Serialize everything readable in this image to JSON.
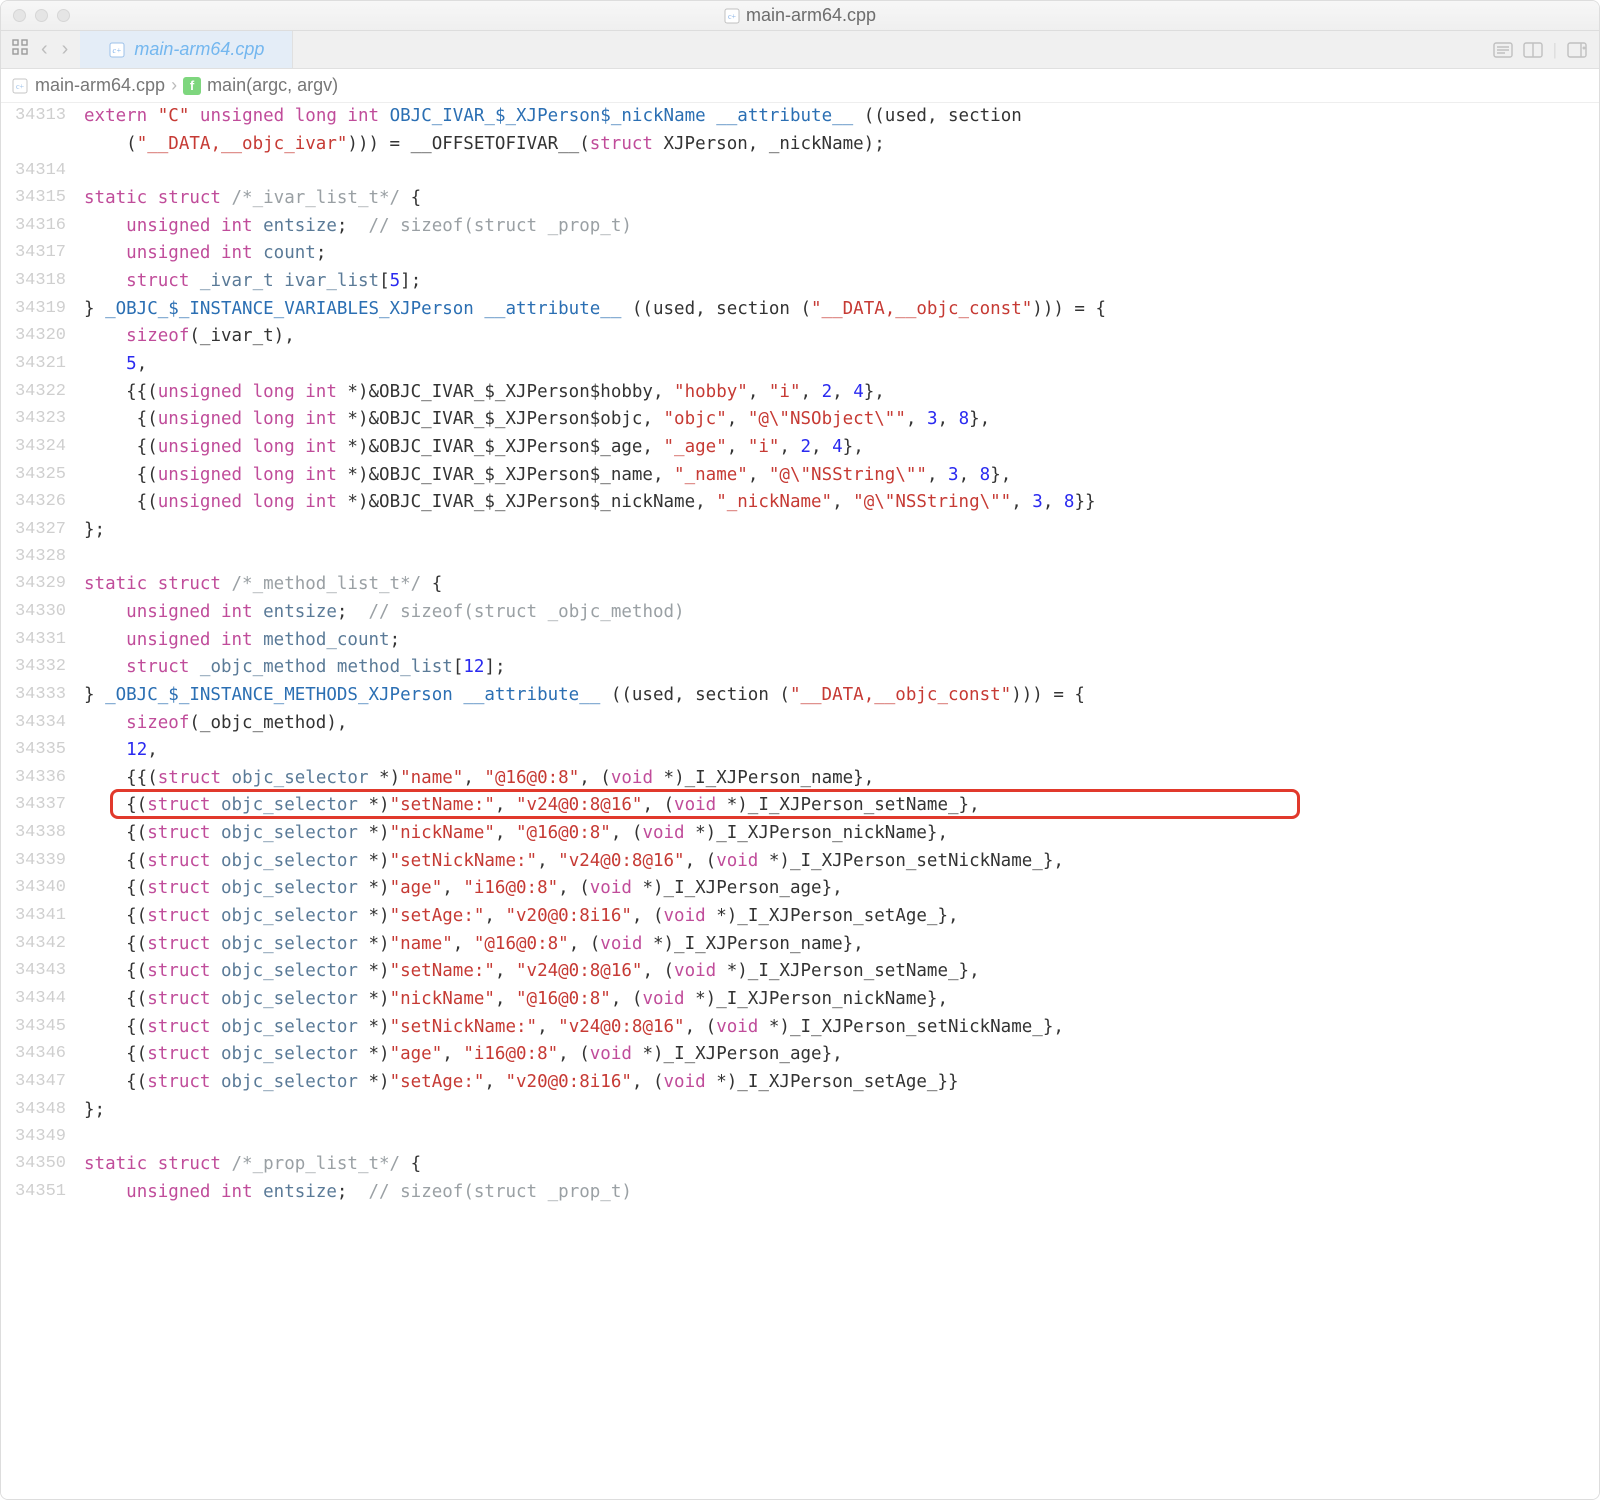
{
  "window": {
    "title": "main-arm64.cpp"
  },
  "tab": {
    "label": "main-arm64.cpp"
  },
  "breadcrumb": {
    "file": "main-arm64.cpp",
    "symbol": "main(argc, argv)"
  },
  "code": {
    "first_visible_line": 34313,
    "lines": [
      {
        "n": 34313,
        "html": "<span class='kw'>extern</span> <span class='str'>\"C\"</span> <span class='kw'>unsigned long int</span> <span class='idf'>OBJC_IVAR_$_XJPerson$_nickName</span> <span class='idf'>__attribute__</span> ((used, section"
      },
      {
        "n": null,
        "html": "    (<span class='str'>\"__DATA,__objc_ivar\"</span>))) = __OFFSETOFIVAR__(<span class='kw'>struct</span> XJPerson, _nickName);"
      },
      {
        "n": 34314,
        "html": ""
      },
      {
        "n": 34315,
        "html": "<span class='kw'>static struct</span> <span class='cm'>/*_ivar_list_t*/</span> {"
      },
      {
        "n": 34316,
        "html": "    <span class='kw'>unsigned int</span> <span class='ty'>entsize</span>;  <span class='cm'>// sizeof(struct _prop_t)</span>"
      },
      {
        "n": 34317,
        "html": "    <span class='kw'>unsigned int</span> <span class='ty'>count</span>;"
      },
      {
        "n": 34318,
        "html": "    <span class='kw'>struct</span> <span class='ty'>_ivar_t</span> <span class='ty'>ivar_list</span>[<span class='num'>5</span>];"
      },
      {
        "n": 34319,
        "html": "} <span class='idf'>_OBJC_$_INSTANCE_VARIABLES_XJPerson</span> <span class='idf'>__attribute__</span> ((used, section (<span class='str'>\"__DATA,__objc_const\"</span>))) = {"
      },
      {
        "n": 34320,
        "html": "    <span class='kw'>sizeof</span>(_ivar_t),"
      },
      {
        "n": 34321,
        "html": "    <span class='num'>5</span>,"
      },
      {
        "n": 34322,
        "html": "    {{(<span class='kw'>unsigned long int</span> *)&amp;OBJC_IVAR_$_XJPerson$hobby, <span class='str'>\"hobby\"</span>, <span class='str'>\"i\"</span>, <span class='num'>2</span>, <span class='num'>4</span>},"
      },
      {
        "n": 34323,
        "html": "     {(<span class='kw'>unsigned long int</span> *)&amp;OBJC_IVAR_$_XJPerson$objc, <span class='str'>\"objc\"</span>, <span class='str'>\"@\\\"NSObject\\\"\"</span>, <span class='num'>3</span>, <span class='num'>8</span>},"
      },
      {
        "n": 34324,
        "html": "     {(<span class='kw'>unsigned long int</span> *)&amp;OBJC_IVAR_$_XJPerson$_age, <span class='str'>\"_age\"</span>, <span class='str'>\"i\"</span>, <span class='num'>2</span>, <span class='num'>4</span>},"
      },
      {
        "n": 34325,
        "html": "     {(<span class='kw'>unsigned long int</span> *)&amp;OBJC_IVAR_$_XJPerson$_name, <span class='str'>\"_name\"</span>, <span class='str'>\"@\\\"NSString\\\"\"</span>, <span class='num'>3</span>, <span class='num'>8</span>},"
      },
      {
        "n": 34326,
        "html": "     {(<span class='kw'>unsigned long int</span> *)&amp;OBJC_IVAR_$_XJPerson$_nickName, <span class='str'>\"_nickName\"</span>, <span class='str'>\"@\\\"NSString\\\"\"</span>, <span class='num'>3</span>, <span class='num'>8</span>}}"
      },
      {
        "n": 34327,
        "html": "};"
      },
      {
        "n": 34328,
        "html": ""
      },
      {
        "n": 34329,
        "html": "<span class='kw'>static struct</span> <span class='cm'>/*_method_list_t*/</span> {"
      },
      {
        "n": 34330,
        "html": "    <span class='kw'>unsigned int</span> <span class='ty'>entsize</span>;  <span class='cm'>// sizeof(struct _objc_method)</span>"
      },
      {
        "n": 34331,
        "html": "    <span class='kw'>unsigned int</span> <span class='ty'>method_count</span>;"
      },
      {
        "n": 34332,
        "html": "    <span class='kw'>struct</span> <span class='ty'>_objc_method</span> <span class='ty'>method_list</span>[<span class='num'>12</span>];"
      },
      {
        "n": 34333,
        "html": "} <span class='idf'>_OBJC_$_INSTANCE_METHODS_XJPerson</span> <span class='idf'>__attribute__</span> ((used, section (<span class='str'>\"__DATA,__objc_const\"</span>))) = {"
      },
      {
        "n": 34334,
        "html": "    <span class='kw'>sizeof</span>(_objc_method),"
      },
      {
        "n": 34335,
        "html": "    <span class='num'>12</span>,"
      },
      {
        "n": 34336,
        "html": "    {{(<span class='kw'>struct</span> <span class='ty'>objc_selector</span> *)<span class='str'>\"name\"</span>, <span class='str'>\"@16@0:8\"</span>, (<span class='kw'>void</span> *)_I_XJPerson_name},"
      },
      {
        "n": 34337,
        "hl": true,
        "html": "    {(<span class='kw'>struct</span> <span class='ty'>objc_selector</span> *)<span class='str'>\"setName:\"</span>, <span class='str'>\"v24@0:8@16\"</span>, (<span class='kw'>void</span> *)_I_XJPerson_setName_},"
      },
      {
        "n": 34338,
        "html": "    {(<span class='kw'>struct</span> <span class='ty'>objc_selector</span> *)<span class='str'>\"nickName\"</span>, <span class='str'>\"@16@0:8\"</span>, (<span class='kw'>void</span> *)_I_XJPerson_nickName},"
      },
      {
        "n": 34339,
        "html": "    {(<span class='kw'>struct</span> <span class='ty'>objc_selector</span> *)<span class='str'>\"setNickName:\"</span>, <span class='str'>\"v24@0:8@16\"</span>, (<span class='kw'>void</span> *)_I_XJPerson_setNickName_},"
      },
      {
        "n": 34340,
        "html": "    {(<span class='kw'>struct</span> <span class='ty'>objc_selector</span> *)<span class='str'>\"age\"</span>, <span class='str'>\"i16@0:8\"</span>, (<span class='kw'>void</span> *)_I_XJPerson_age},"
      },
      {
        "n": 34341,
        "html": "    {(<span class='kw'>struct</span> <span class='ty'>objc_selector</span> *)<span class='str'>\"setAge:\"</span>, <span class='str'>\"v20@0:8i16\"</span>, (<span class='kw'>void</span> *)_I_XJPerson_setAge_},"
      },
      {
        "n": 34342,
        "html": "    {(<span class='kw'>struct</span> <span class='ty'>objc_selector</span> *)<span class='str'>\"name\"</span>, <span class='str'>\"@16@0:8\"</span>, (<span class='kw'>void</span> *)_I_XJPerson_name},"
      },
      {
        "n": 34343,
        "html": "    {(<span class='kw'>struct</span> <span class='ty'>objc_selector</span> *)<span class='str'>\"setName:\"</span>, <span class='str'>\"v24@0:8@16\"</span>, (<span class='kw'>void</span> *)_I_XJPerson_setName_},"
      },
      {
        "n": 34344,
        "html": "    {(<span class='kw'>struct</span> <span class='ty'>objc_selector</span> *)<span class='str'>\"nickName\"</span>, <span class='str'>\"@16@0:8\"</span>, (<span class='kw'>void</span> *)_I_XJPerson_nickName},"
      },
      {
        "n": 34345,
        "html": "    {(<span class='kw'>struct</span> <span class='ty'>objc_selector</span> *)<span class='str'>\"setNickName:\"</span>, <span class='str'>\"v24@0:8@16\"</span>, (<span class='kw'>void</span> *)_I_XJPerson_setNickName_},"
      },
      {
        "n": 34346,
        "html": "    {(<span class='kw'>struct</span> <span class='ty'>objc_selector</span> *)<span class='str'>\"age\"</span>, <span class='str'>\"i16@0:8\"</span>, (<span class='kw'>void</span> *)_I_XJPerson_age},"
      },
      {
        "n": 34347,
        "html": "    {(<span class='kw'>struct</span> <span class='ty'>objc_selector</span> *)<span class='str'>\"setAge:\"</span>, <span class='str'>\"v20@0:8i16\"</span>, (<span class='kw'>void</span> *)_I_XJPerson_setAge_}}"
      },
      {
        "n": 34348,
        "html": "};"
      },
      {
        "n": 34349,
        "html": ""
      },
      {
        "n": 34350,
        "html": "<span class='kw'>static struct</span> <span class='cm'>/*_prop_list_t*/</span> {"
      },
      {
        "n": 34351,
        "html": "    <span class='kw'>unsigned int</span> <span class='ty'>entsize</span>;  <span class='cm'>// sizeof(struct _prop_t)</span>"
      }
    ],
    "highlight_line": 34337
  }
}
